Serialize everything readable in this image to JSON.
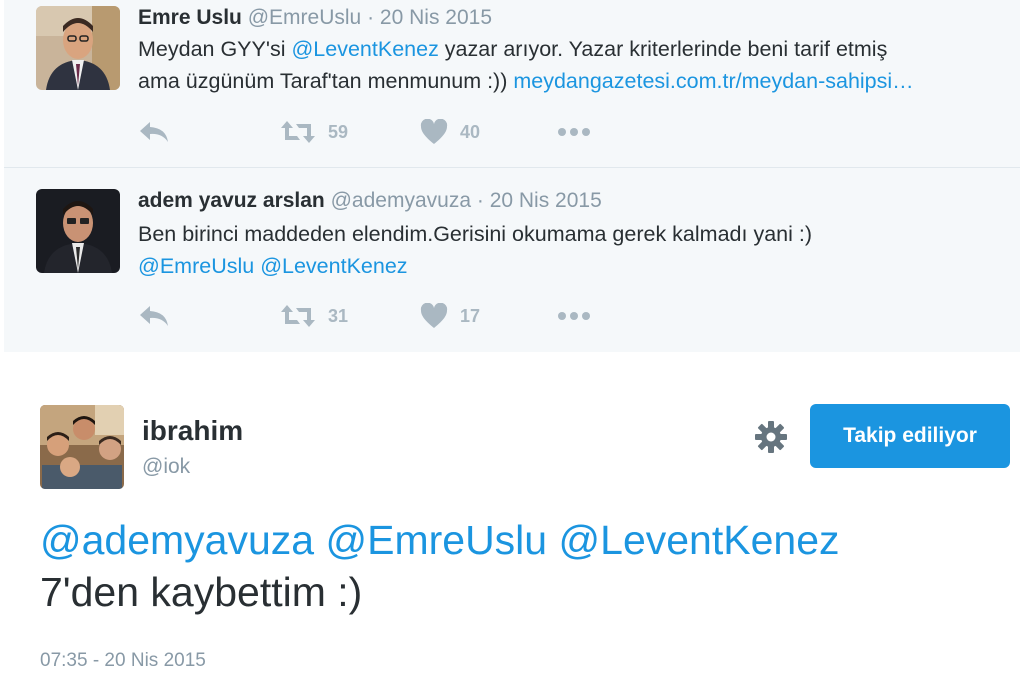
{
  "replies": [
    {
      "name": "Emre Uslu",
      "handle": "@EmreUslu",
      "separator": "·",
      "date": "20 Nis 2015",
      "line1_prefix": "Meydan GYY'si ",
      "line1_mention": "@LeventKenez",
      "line1_suffix": " yazar arıyor. Yazar kriterlerinde beni tarif etmiş",
      "line2_text": "ama üzgünüm Taraf'tan menmunum :)) ",
      "line2_link": "meydangazetesi.com.tr/meydan-sahipsi…",
      "retweets": "59",
      "likes": "40"
    },
    {
      "name": "adem yavuz arslan",
      "handle": "@ademyavuza",
      "separator": "·",
      "date": "20 Nis 2015",
      "line1_text": "Ben birinci maddeden elendim.Gerisini okumama gerek kalmadı yani :)",
      "line2_mention1": "@EmreUslu",
      "line2_mention2": "@LeventKenez",
      "retweets": "31",
      "likes": "17"
    }
  ],
  "main_tweet": {
    "name": "ibrahim",
    "handle": "@iok",
    "follow_label": "Takip ediliyor",
    "mention1": "@ademyavuza",
    "mention2": "@EmreUslu",
    "mention3": "@LeventKenez",
    "line2": "7'den kaybettim :)",
    "timestamp": "07:35 - 20 Nis 2015"
  },
  "icons": {
    "reply": "reply-icon",
    "retweet": "retweet-icon",
    "like": "heart-icon",
    "more": "more-dots-icon",
    "settings": "gear-icon"
  },
  "colors": {
    "link": "#1b95e0",
    "muted": "#8899a6",
    "action": "#aab8c2",
    "button": "#1b95e0",
    "reply_bg": "#f5f8fa"
  }
}
